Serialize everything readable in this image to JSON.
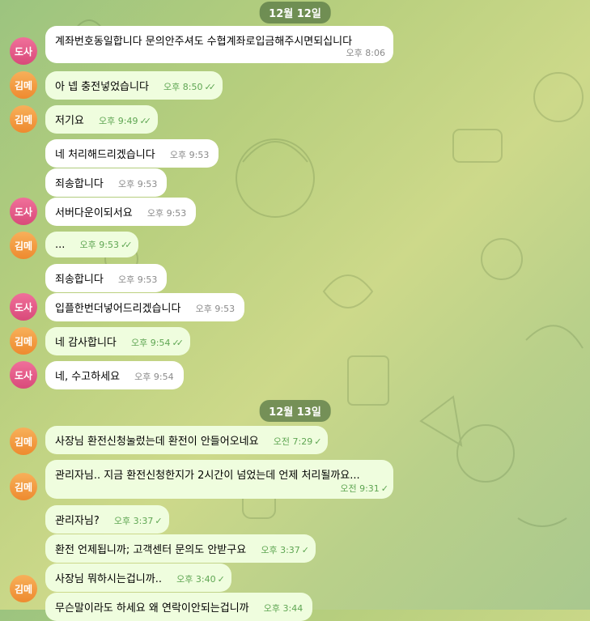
{
  "dates": [
    "12월 12일",
    "12월 13일"
  ],
  "senders": {
    "a": "도사",
    "b": "김메"
  },
  "messages": [
    {
      "text": "계좌번호동일합니다 문의안주셔도 수협계좌로입금해주시면되십니다",
      "time": "오후 8:06"
    },
    {
      "text": "아 넵 충전넣었습니다",
      "time": "오후 8:50"
    },
    {
      "text": "저기요",
      "time": "오후 9:49"
    },
    {
      "text": "네 처리해드리겠습니다",
      "time": "오후 9:53"
    },
    {
      "text": "죄송합니다",
      "time": "오후 9:53"
    },
    {
      "text": "서버다운이되서요",
      "time": "오후 9:53"
    },
    {
      "text": "...",
      "time": "오후 9:53"
    },
    {
      "text": "죄송합니다",
      "time": "오후 9:53"
    },
    {
      "text": "입플한번더넣어드리겠습니다",
      "time": "오후 9:53"
    },
    {
      "text": "네 감사합니다",
      "time": "오후 9:54"
    },
    {
      "text": "네, 수고하세요",
      "time": "오후 9:54"
    },
    {
      "text": "사장님 환전신청눌렀는데 환전이 안들어오네요",
      "time": "오전 7:29"
    },
    {
      "text": "관리자님.. 지금 환전신청한지가 2시간이 넘었는데 언제 처리될까요...",
      "time": "오전 9:31"
    },
    {
      "text": "관리자님?",
      "time": "오후 3:37"
    },
    {
      "text": "환전 언제됩니까; 고객센터 문의도 안받구요",
      "time": "오후 3:37"
    },
    {
      "text": "사장님 뭐하시는겁니까..",
      "time": "오후 3:40"
    },
    {
      "text": "무슨말이라도 하세요 왜 연락이안되는겁니까",
      "time": "오후 3:44"
    }
  ],
  "colors": {
    "incoming": "#ffffff",
    "outgoing": "#effdde",
    "check": "#5fa653"
  }
}
